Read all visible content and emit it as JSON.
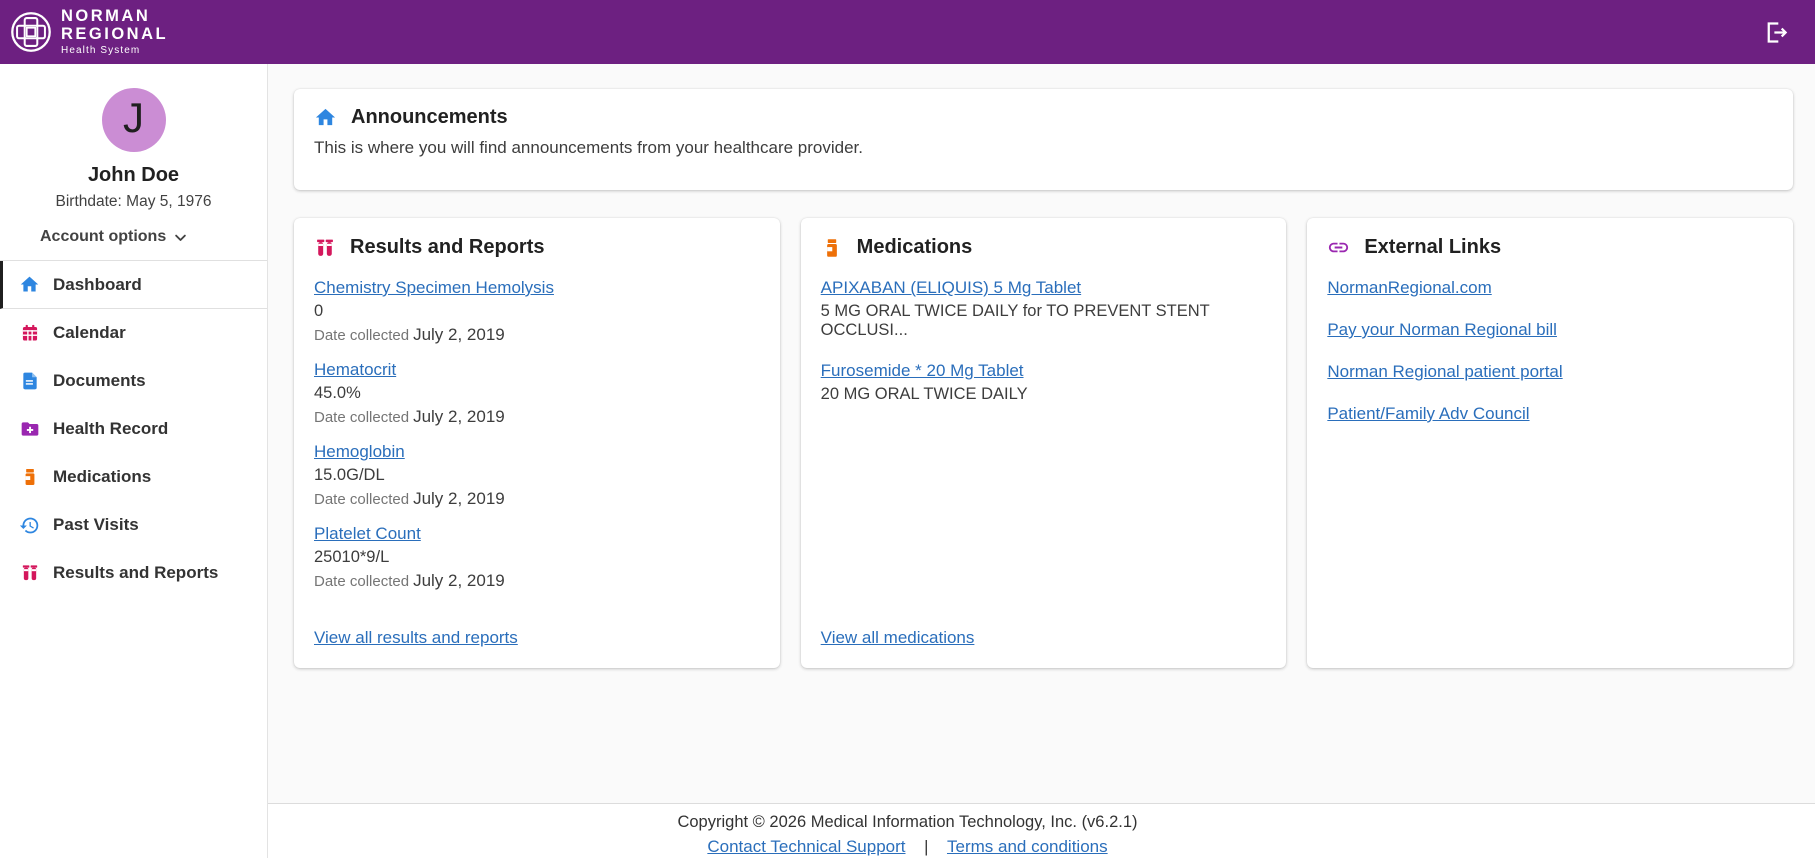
{
  "header": {
    "brand_line1": "NORMAN",
    "brand_line2": "REGIONAL",
    "brand_line3": "Health System",
    "logout_icon": "logout-icon"
  },
  "sidebar": {
    "user": {
      "initial": "J",
      "name": "John Doe",
      "birthdate": "Birthdate: May 5, 1976"
    },
    "account_options_label": "Account options",
    "items": [
      {
        "label": "Dashboard",
        "icon": "home-icon",
        "active": true
      },
      {
        "label": "Calendar",
        "icon": "calendar-icon",
        "active": false
      },
      {
        "label": "Documents",
        "icon": "document-icon",
        "active": false
      },
      {
        "label": "Health Record",
        "icon": "folder-plus-icon",
        "active": false
      },
      {
        "label": "Medications",
        "icon": "pill-bottle-icon",
        "active": false
      },
      {
        "label": "Past Visits",
        "icon": "history-icon",
        "active": false
      },
      {
        "label": "Results and Reports",
        "icon": "test-tubes-icon",
        "active": false
      }
    ]
  },
  "announcements": {
    "title": "Announcements",
    "icon": "home-icon",
    "body": "This is where you will find announcements from your healthcare provider."
  },
  "results": {
    "title": "Results and Reports",
    "icon": "test-tubes-icon",
    "date_label": "Date collected",
    "items": [
      {
        "name": "Chemistry Specimen Hemolysis",
        "value": "0",
        "date": "July 2, 2019"
      },
      {
        "name": "Hematocrit",
        "value": "45.0%",
        "date": "July 2, 2019"
      },
      {
        "name": "Hemoglobin",
        "value": "15.0G/DL",
        "date": "July 2, 2019"
      },
      {
        "name": "Platelet Count",
        "value": "25010*9/L",
        "date": "July 2, 2019"
      }
    ],
    "view_all": "View all results and reports"
  },
  "medications": {
    "title": "Medications",
    "icon": "pill-bottle-icon",
    "items": [
      {
        "name": "APIXABAN (ELIQUIS) 5 Mg Tablet",
        "sig": "5 MG ORAL TWICE DAILY for TO PREVENT STENT OCCLUSI..."
      },
      {
        "name": "Furosemide * 20 Mg Tablet",
        "sig": "20 MG ORAL TWICE DAILY"
      }
    ],
    "view_all": "View all medications"
  },
  "external_links": {
    "title": "External Links",
    "icon": "link-icon",
    "links": [
      "NormanRegional.com",
      "Pay your Norman Regional bill",
      "Norman Regional patient portal",
      "Patient/Family Adv Council"
    ]
  },
  "footer": {
    "copyright": "Copyright © 2026  Medical Information Technology, Inc.  (v6.2.1)",
    "support_link": "Contact Technical Support",
    "separator": "|",
    "terms_link": "Terms and conditions"
  },
  "colors": {
    "header_purple": "#6D2081",
    "link_blue": "#2A6EBB",
    "icon_blue": "#2E86E0",
    "icon_pink": "#D4175C",
    "icon_orange": "#EE7008",
    "icon_purple": "#9A27B0",
    "avatar_bg": "#CB8DD4"
  }
}
